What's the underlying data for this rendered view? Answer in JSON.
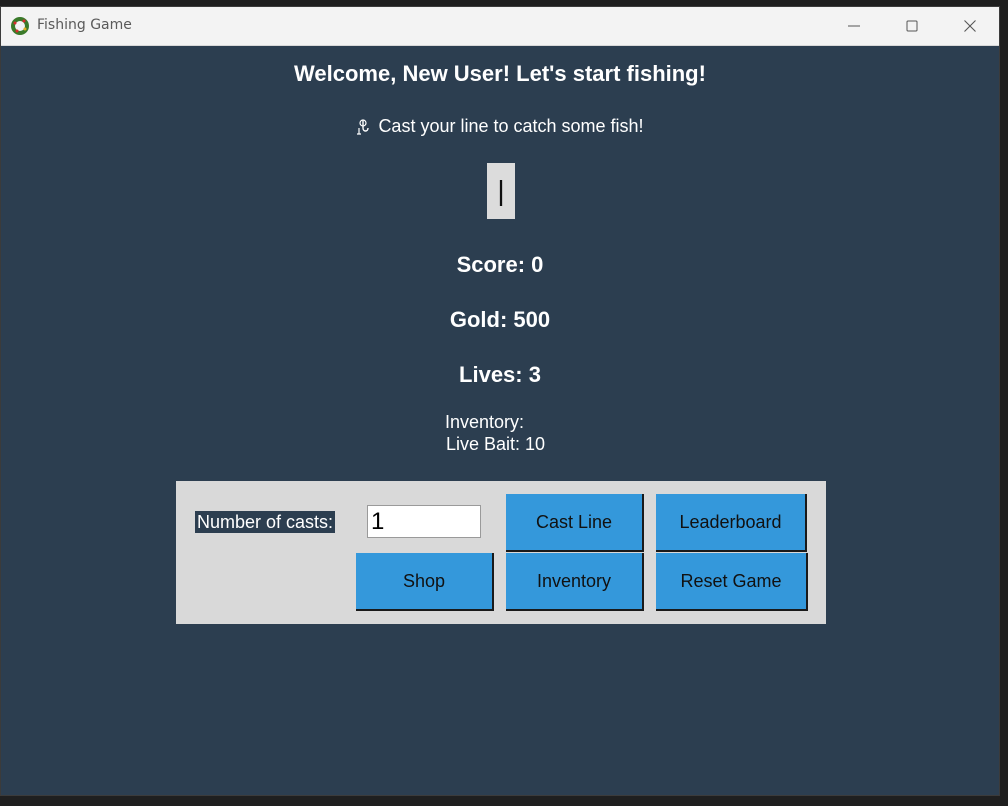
{
  "window": {
    "title": "Fishing Game"
  },
  "main": {
    "welcome": "Welcome, New User! Let's start fishing!",
    "cast_message": "Cast your line to catch some fish!",
    "bobber_glyph": "|",
    "score": "Score: 0",
    "gold": "Gold: 500",
    "lives": "Lives: 3",
    "inventory_title": "Inventory:",
    "inventory_item": "Live Bait: 10"
  },
  "controls": {
    "casts_label": "Number of casts:",
    "casts_value": "1",
    "cast_line": "Cast Line",
    "leaderboard": "Leaderboard",
    "shop": "Shop",
    "inventory": "Inventory",
    "reset_game": "Reset Game"
  },
  "colors": {
    "background": "#2c3e50",
    "button": "#3498db",
    "panel": "#d9d9d9"
  },
  "icons": {
    "app": "wreath-icon",
    "message": "hook-icon"
  }
}
